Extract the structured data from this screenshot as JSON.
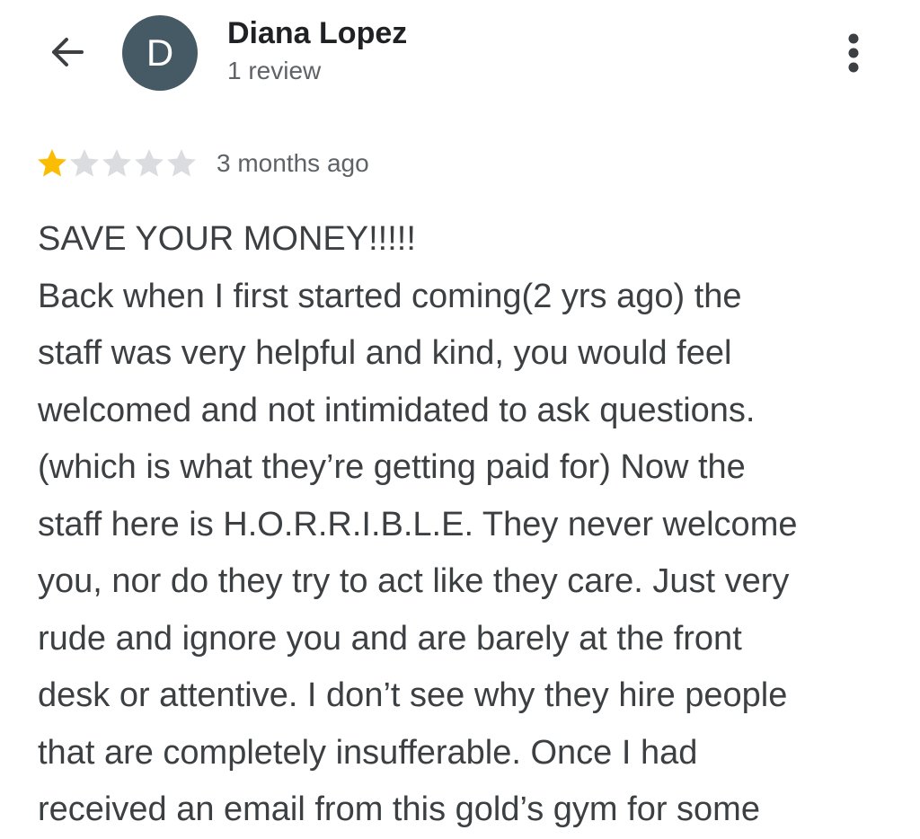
{
  "header": {
    "avatar_letter": "D",
    "avatar_color": "#455a64",
    "user_name": "Diana Lopez",
    "review_count": "1 review",
    "back_icon": "arrow-back-icon",
    "more_icon": "more-vert-icon"
  },
  "review": {
    "rating": 1,
    "max_rating": 5,
    "star_filled_color": "#fbbc04",
    "star_empty_color": "#dadce0",
    "date": "3 months ago",
    "lines": [
      "SAVE YOUR MONEY!!!!!",
      "Back when I first started coming(2 yrs ago) the",
      "staff was very helpful and kind, you would feel",
      "welcomed and not intimidated to ask questions.",
      "(which is what they’re getting paid for) Now the",
      "staff here is H.O.R.R.I.B.L.E. They never welcome",
      "you, nor do they try to act like they care. Just very",
      "rude and ignore you and are barely at the front",
      "desk or attentive. I don’t see why they hire people",
      "that are completely insufferable. Once I had",
      "received an email from this gold’s gym for some"
    ]
  }
}
